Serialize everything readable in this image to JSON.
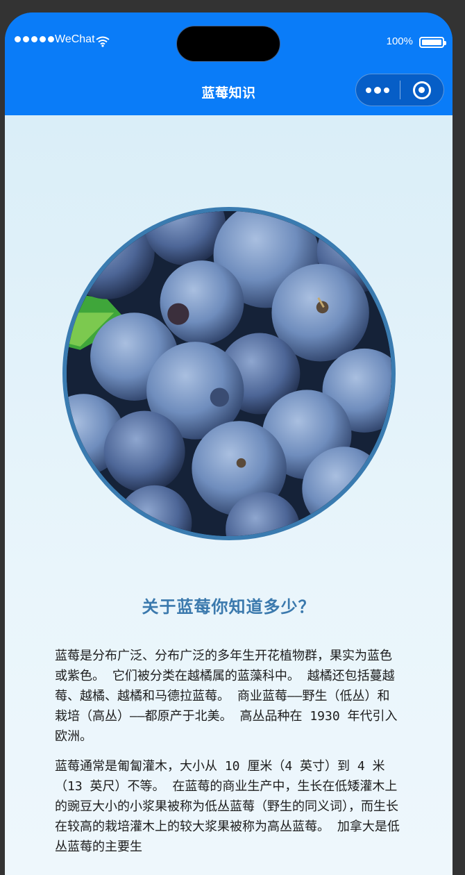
{
  "status_bar": {
    "carrier": "WeChat",
    "battery_percent": "100%",
    "battery_level": 1.0
  },
  "nav": {
    "title": "蓝莓知识",
    "more_icon": "more-dots-icon",
    "close_icon": "target-close-icon"
  },
  "hero": {
    "image_subject": "blueberries close-up"
  },
  "article": {
    "heading": "关于蓝莓你知道多少？",
    "paragraphs": [
      "蓝莓是分布广泛、分布广泛的多年生开花植物群，果实为蓝色或紫色。 它们被分类在越橘属的蓝藻科中。 越橘还包括蔓越莓、越橘、越橘和马德拉蓝莓。 商业蓝莓——野生（低丛）和栽培（高丛）——都原产于北美。 高丛品种在 1930 年代引入欧洲。",
      "蓝莓通常是匍匐灌木，大小从 10 厘米（4 英寸）到 4 米（13 英尺）不等。 在蓝莓的商业生产中，生长在低矮灌木上的豌豆大小的小浆果被称为低丛蓝莓（野生的同义词），而生长在较高的栽培灌木上的较大浆果被称为高丛蓝莓。 加拿大是低丛蓝莓的主要生"
    ]
  },
  "colors": {
    "nav_bar": "#0a7cf8",
    "heading": "#3b79ad",
    "hero_border": "#3a7bb0",
    "background": "#e3f2fa"
  }
}
